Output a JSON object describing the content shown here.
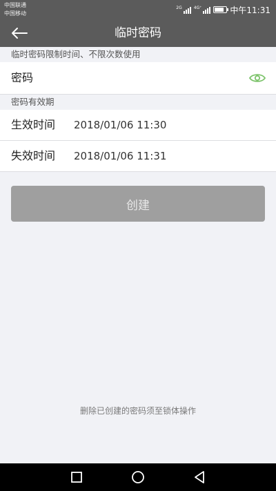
{
  "status_bar": {
    "carrier1": "中国联通",
    "carrier2": "中国移动",
    "signal1_tag": "2G",
    "signal2_tag": "4G⁺",
    "time": "中午11:31"
  },
  "header": {
    "title": "临时密码",
    "back_icon": "arrow-left-icon"
  },
  "password_section": {
    "hint": "临时密码限制时间、不限次数使用",
    "label": "密码",
    "value": "",
    "visibility_icon": "eye-icon",
    "accent_color": "#7cc36a"
  },
  "validity_section": {
    "title": "密码有效期",
    "start_label": "生效时间",
    "start_value": "2018/01/06 11:30",
    "end_label": "失效时间",
    "end_value": "2018/01/06 11:31"
  },
  "actions": {
    "create_label": "创建"
  },
  "footer": {
    "note": "删除已创建的密码须至锁体操作"
  },
  "nav_bar": {
    "recent_icon": "square-icon",
    "home_icon": "circle-icon",
    "back_icon": "triangle-back-icon"
  }
}
